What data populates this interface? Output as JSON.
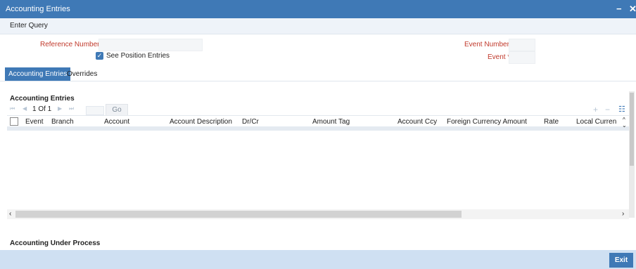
{
  "window": {
    "title": "Accounting Entries",
    "minimize": "−",
    "close": "✕"
  },
  "toolbar": {
    "enter_query": "Enter Query"
  },
  "form": {
    "reference_number_label": "Reference Number",
    "see_position_entries_label": "See Position Entries",
    "event_number_label": "Event Number",
    "event_label": "Event",
    "required_mark": "*"
  },
  "tabs": [
    {
      "label": "Accounting Entries",
      "active": true
    },
    {
      "label": "Overrides",
      "active": false
    }
  ],
  "accounting_entries": {
    "title": "Accounting Entries",
    "pagination": {
      "first": "⏮",
      "prev": "◀",
      "page_text": "1 Of 1",
      "next": "▶",
      "last": "⏭",
      "go": "Go"
    },
    "actions": {
      "add": "+",
      "remove": "−",
      "view": "☷"
    },
    "columns": [
      "Event",
      "Branch",
      "Account",
      "Account Description",
      "Dr/Cr",
      "Amount Tag",
      "Account Ccy",
      "Foreign Currency Amount",
      "Rate",
      "Local Curren"
    ]
  },
  "accounting_under_process": {
    "title": "Accounting Under Process"
  },
  "footer": {
    "exit_label": "Exit"
  },
  "colors": {
    "accent": "#3f79b6",
    "footer": "#cfe0f2",
    "required": "#c0392b"
  },
  "icons": [
    "checkbox-checked-icon",
    "minimize-icon",
    "close-icon",
    "first-page-icon",
    "prev-page-icon",
    "next-page-icon",
    "last-page-icon",
    "add-row-icon",
    "delete-row-icon",
    "view-icon",
    "scroll-up-icon",
    "scroll-down-icon",
    "scroll-left-icon",
    "scroll-right-icon"
  ]
}
